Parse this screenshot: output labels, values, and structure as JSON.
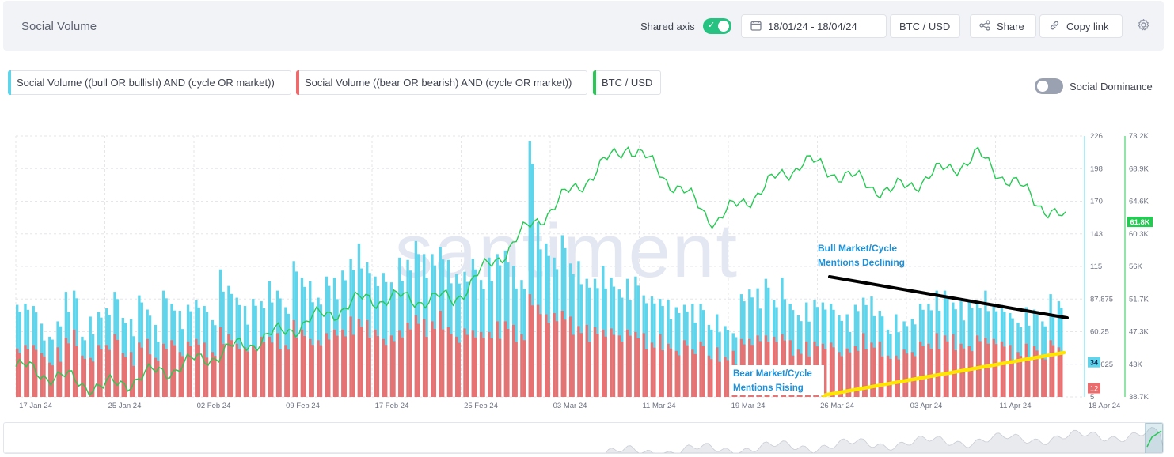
{
  "header": {
    "title": "Social Volume",
    "shared_axis_label": "Shared axis",
    "date_range": "18/01/24 - 18/04/24",
    "pair": "BTC / USD",
    "share_label": "Share",
    "copy_link_label": "Copy link",
    "icons": {
      "calendar": "calendar-icon",
      "share": "share-icon",
      "link": "link-icon",
      "settings": "gear-icon"
    }
  },
  "legend": [
    {
      "label": "Social Volume ((bull OR bullish) AND (cycle OR market))",
      "color": "#5fd5ec"
    },
    {
      "label": "Social Volume ((bear OR bearish) AND (cycle OR market))",
      "color": "#ef6b6b"
    },
    {
      "label": "BTC / USD",
      "color": "#26c953"
    }
  ],
  "social_dominance_label": "Social Dominance",
  "colors": {
    "bull": "#5fd5ec",
    "bear": "#ef6b6b",
    "price": "#26c953",
    "grid": "#e4e6ea",
    "accent": "#26c281"
  },
  "chart_data": {
    "type": "bar",
    "watermark": "santiment",
    "x_start": "17 Jan 24",
    "x_end": "18 Apr 24",
    "x_ticks": [
      "17 Jan 24",
      "25 Jan 24",
      "02 Feb 24",
      "09 Feb 24",
      "17 Feb 24",
      "25 Feb 24",
      "03 Mar 24",
      "11 Mar 24",
      "19 Mar 24",
      "26 Mar 24",
      "03 Apr 24",
      "11 Apr 24",
      "18 Apr 24"
    ],
    "y_left": {
      "ticks": [
        "226",
        "198",
        "170",
        "143",
        "115",
        "87.875",
        "60.25",
        "32.625",
        "5"
      ],
      "range": [
        5,
        226
      ]
    },
    "y_right": {
      "ticks": [
        "73.2K",
        "68.9K",
        "64.6K",
        "60.3K",
        "56K",
        "51.7K",
        "47.3K",
        "43K",
        "38.7K"
      ],
      "range": [
        38700,
        73200
      ]
    },
    "last_values": {
      "bull": "34",
      "bear": "12",
      "price": "61.8K"
    },
    "series": [
      {
        "name": "Social Volume ((bull OR bullish) AND (cycle OR market))",
        "axis": "left",
        "daily_points": [
          88,
          82,
          84,
          62,
          55,
          72,
          90,
          95,
          60,
          70,
          78,
          85,
          92,
          74,
          66,
          90,
          82,
          62,
          95,
          88,
          75,
          84,
          92,
          80,
          72,
          108,
          98,
          92,
          78,
          88,
          90,
          100,
          96,
          86,
          118,
          108,
          98,
          88,
          110,
          102,
          112,
          126,
          132,
          120,
          112,
          108,
          104,
          118,
          120,
          140,
          122,
          126,
          136,
          118,
          110,
          116,
          120,
          106,
          118,
          125,
          132,
          112,
          104,
          226,
          150,
          136,
          128,
          140,
          120,
          115,
          104,
          108,
          112,
          106,
          100,
          102,
          108,
          96,
          88,
          90,
          82,
          80,
          86,
          80,
          84,
          70,
          72,
          66,
          64,
          90,
          98,
          92,
          104,
          90,
          102,
          84,
          78,
          82,
          88,
          90,
          82,
          76,
          70,
          82,
          92,
          86,
          78,
          66,
          72,
          70,
          76,
          82,
          86,
          90,
          94,
          88,
          82,
          86,
          90,
          92,
          84,
          88,
          74,
          70,
          76,
          78,
          72,
          88,
          86
        ]
      },
      {
        "name": "Social Volume ((bear OR bearish) AND (cycle OR market))",
        "axis": "left",
        "daily_points": [
          50,
          48,
          52,
          40,
          36,
          44,
          56,
          58,
          40,
          42,
          48,
          52,
          56,
          44,
          40,
          52,
          50,
          38,
          54,
          52,
          46,
          50,
          56,
          48,
          44,
          60,
          58,
          54,
          46,
          52,
          54,
          58,
          56,
          50,
          66,
          62,
          58,
          52,
          62,
          60,
          64,
          70,
          72,
          66,
          62,
          58,
          56,
          64,
          66,
          76,
          68,
          70,
          74,
          64,
          60,
          62,
          64,
          58,
          62,
          66,
          70,
          62,
          58,
          96,
          82,
          78,
          74,
          80,
          70,
          66,
          62,
          64,
          66,
          62,
          60,
          60,
          62,
          56,
          52,
          54,
          50,
          48,
          52,
          48,
          50,
          42,
          44,
          40,
          40,
          54,
          58,
          56,
          60,
          54,
          60,
          50,
          46,
          48,
          52,
          54,
          50,
          46,
          44,
          50,
          56,
          52,
          48,
          40,
          44,
          44,
          46,
          50,
          52,
          56,
          58,
          54,
          50,
          52,
          56,
          58,
          52,
          54,
          46,
          44,
          46,
          48,
          44,
          52,
          50
        ]
      },
      {
        "name": "BTC / USD",
        "axis": "right",
        "weekly_points": [
          [
            "17 Jan 24",
            42700
          ],
          [
            "25 Jan 24",
            39900
          ],
          [
            "02 Feb 24",
            43200
          ],
          [
            "09 Feb 24",
            47100
          ],
          [
            "17 Feb 24",
            51700
          ],
          [
            "25 Feb 24",
            51600
          ],
          [
            "03 Mar 24",
            62500
          ],
          [
            "11 Mar 24",
            72100
          ],
          [
            "19 Mar 24",
            62000
          ],
          [
            "26 Mar 24",
            69900
          ],
          [
            "03 Apr 24",
            65800
          ],
          [
            "11 Apr 24",
            70500
          ],
          [
            "18 Apr 24",
            61800
          ]
        ]
      }
    ],
    "annotations": [
      {
        "text": [
          "Bull Market/Cycle",
          "Mentions Declining"
        ],
        "color": "#1e90d6"
      },
      {
        "text": [
          "Bear Market/Cycle",
          "Mentions Rising"
        ],
        "color": "#1e90d6"
      }
    ]
  }
}
